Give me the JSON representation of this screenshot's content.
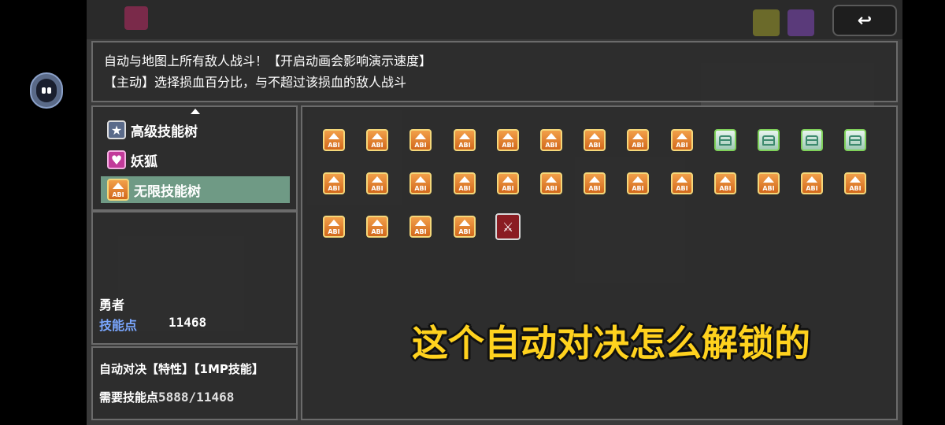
{
  "background_hud": {
    "title": "",
    "name": ""
  },
  "description": {
    "line1": "自动与地图上所有敌人战斗！【开启动画会影响演示速度】",
    "line2": "【主动】选择损血百分比，与不超过该损血的敌人战斗"
  },
  "skill_trees": [
    {
      "label": "高级技能树",
      "icon": "star-icon",
      "selected": false
    },
    {
      "label": "妖狐",
      "icon": "heart-icon",
      "selected": false
    },
    {
      "label": "无限技能树",
      "icon": "abi-icon",
      "selected": true
    }
  ],
  "character": {
    "name": "勇者",
    "skill_points_label": "技能点",
    "skill_points_value": "11468"
  },
  "selected_skill": {
    "title": "自动对决【特性】【1MP技能】",
    "requirement_label": "需要技能点",
    "requirement_value": "5888/11468"
  },
  "skill_grid": {
    "rows": [
      [
        "abi",
        "abi",
        "abi",
        "abi",
        "abi",
        "abi",
        "abi",
        "abi",
        "abi",
        "chest",
        "chest",
        "chest",
        "chest"
      ],
      [
        "abi",
        "abi",
        "abi",
        "abi",
        "abi",
        "abi",
        "abi",
        "abi",
        "abi",
        "abi",
        "abi",
        "abi",
        "abi"
      ],
      [
        "abi",
        "abi",
        "abi",
        "abi",
        "special"
      ]
    ]
  },
  "back_button": {
    "icon": "back-arrow-icon",
    "glyph": "↩"
  },
  "overlay_caption": "这个自动对决怎么解锁的",
  "colors": {
    "accent_selected": "#6f9a85",
    "skill_points_label": "#7aa7ff",
    "caption": "#ffd21e",
    "abi_skill": "#e07a2a",
    "special_skill": "#8a1c22"
  }
}
